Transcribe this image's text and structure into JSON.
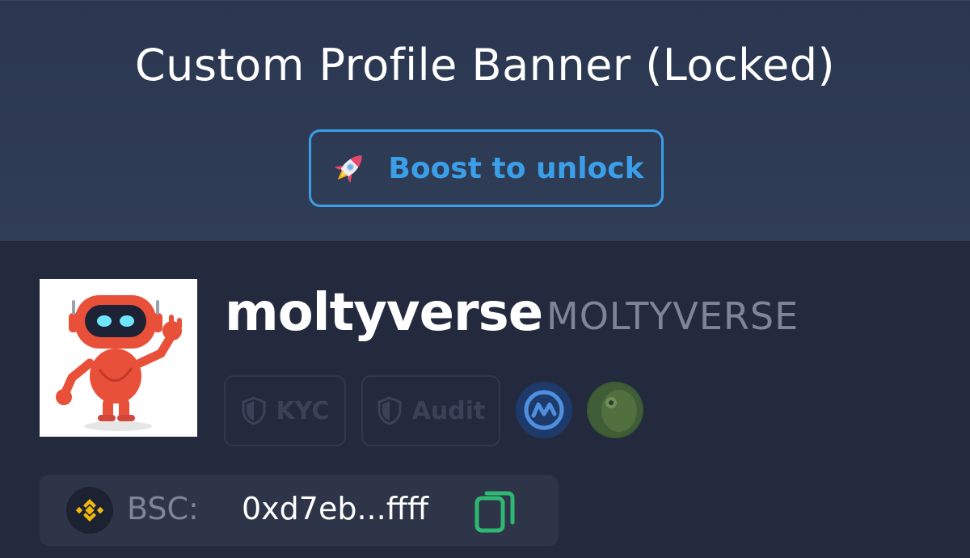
{
  "banner": {
    "title": "Custom Profile Banner (Locked)",
    "boost_label": "Boost to unlock",
    "boost_icon": "rocket-icon",
    "accent_color": "#3a9fe8"
  },
  "profile": {
    "avatar_icon": "robot-avatar",
    "name": "moltyverse",
    "symbol": "MOLTYVERSE",
    "badges": [
      {
        "label": "KYC",
        "icon": "shield-icon"
      },
      {
        "label": "Audit",
        "icon": "shield-icon"
      }
    ],
    "links": [
      {
        "icon": "coinmarketcap-icon",
        "color": "#1e3a6a"
      },
      {
        "icon": "coingecko-icon",
        "color": "#3a5a34"
      }
    ]
  },
  "address": {
    "chain_icon": "bnb-chain-icon",
    "chain": "BSC:",
    "value": "0xd7eb...ffff",
    "copy_icon": "copy-icon",
    "copy_color": "#2eb872"
  }
}
